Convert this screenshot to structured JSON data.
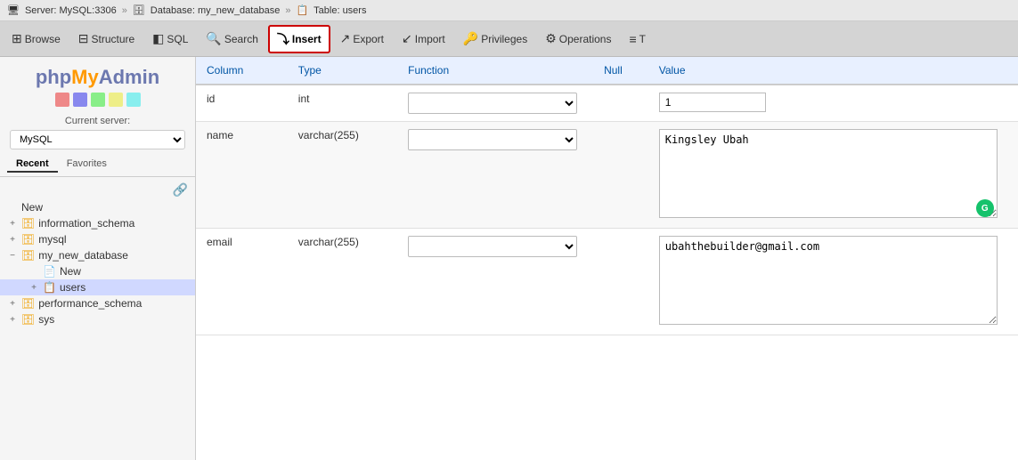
{
  "breadcrumb": {
    "server_icon": "🖥",
    "server_label": "Server: MySQL:3306",
    "sep1": "»",
    "db_icon": "🗄",
    "db_label": "Database: my_new_database",
    "sep2": "»",
    "table_icon": "📋",
    "table_label": "Table: users"
  },
  "toolbar": {
    "browse_label": "Browse",
    "structure_label": "Structure",
    "sql_label": "SQL",
    "search_label": "Search",
    "insert_label": "Insert",
    "export_label": "Export",
    "import_label": "Import",
    "privileges_label": "Privileges",
    "operations_label": "Operations",
    "tracking_label": "T"
  },
  "sidebar": {
    "logo_php": "php",
    "logo_my": "My",
    "logo_admin": "Admin",
    "server_label": "Current server:",
    "server_value": "MySQL",
    "tab_recent": "Recent",
    "tab_favorites": "Favorites",
    "new_label": "New",
    "databases": [
      {
        "name": "information_schema",
        "expanded": false
      },
      {
        "name": "mysql",
        "expanded": false
      },
      {
        "name": "my_new_database",
        "expanded": true,
        "children": [
          {
            "name": "New",
            "is_new": true
          },
          {
            "name": "users",
            "selected": true
          }
        ]
      },
      {
        "name": "performance_schema",
        "expanded": false
      },
      {
        "name": "sys",
        "expanded": false
      }
    ]
  },
  "insert_table": {
    "columns": [
      "Column",
      "Type",
      "Function",
      "Null",
      "Value"
    ],
    "rows": [
      {
        "column": "id",
        "type": "int",
        "function": "",
        "null_checked": false,
        "value_type": "input",
        "value": "1"
      },
      {
        "column": "name",
        "type": "varchar(255)",
        "function": "",
        "null_checked": false,
        "value_type": "textarea",
        "value": "Kingsley Ubah"
      },
      {
        "column": "email",
        "type": "varchar(255)",
        "function": "",
        "null_checked": false,
        "value_type": "textarea",
        "value": "ubahthebuilder@gmail.com"
      }
    ]
  }
}
